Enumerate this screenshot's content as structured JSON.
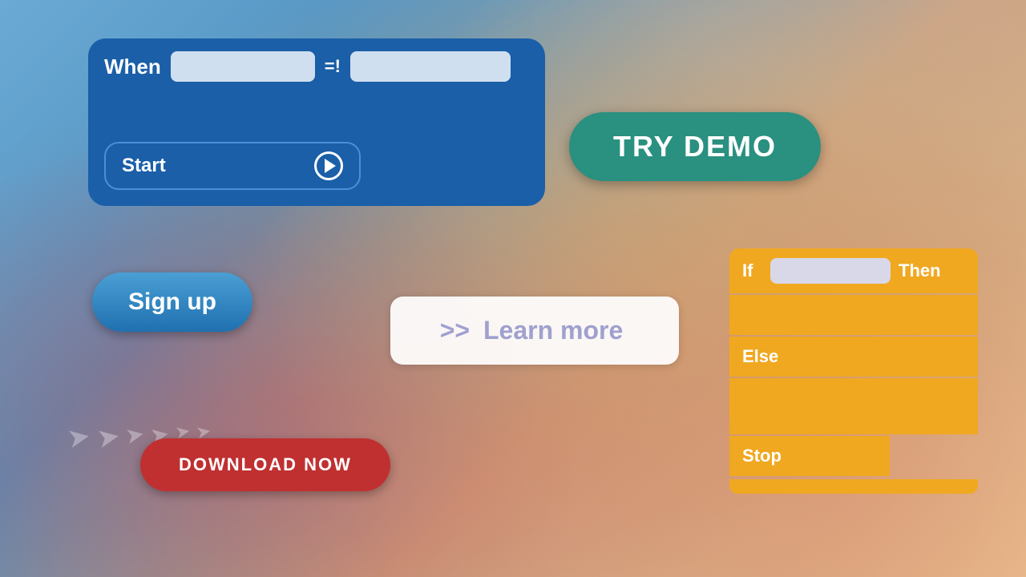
{
  "background": {
    "color_left": "#5a9ac8",
    "color_right": "#d4a870"
  },
  "when_block": {
    "label": "When",
    "equals_label": "=!",
    "input1_placeholder": "",
    "input2_placeholder": "",
    "start_label": "Start"
  },
  "try_demo": {
    "label": "TRY DEMO"
  },
  "signup": {
    "label": "Sign up"
  },
  "learn_more": {
    "prefix": ">>",
    "label": "Learn more"
  },
  "download": {
    "label": "DOWNLOAD NOW"
  },
  "logic_block": {
    "if_label": "If",
    "then_label": "Then",
    "else_label": "Else",
    "stop_label": "Stop",
    "input_placeholder": ""
  }
}
